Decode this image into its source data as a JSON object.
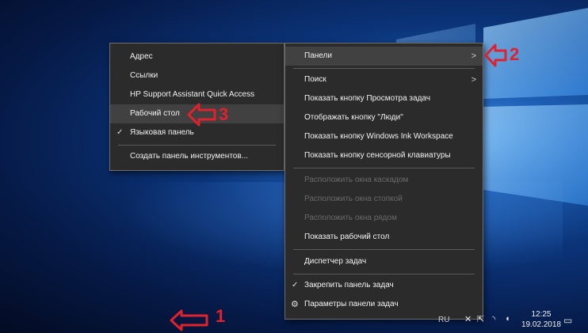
{
  "submenu": {
    "items": [
      {
        "label": "Адрес"
      },
      {
        "label": "Ссылки"
      },
      {
        "label": "HP Support Assistant Quick Access"
      },
      {
        "label": "Рабочий стол"
      },
      {
        "label": "Языковая панель"
      },
      {
        "label": "Создать панель инструментов..."
      }
    ]
  },
  "context_menu": {
    "items": [
      {
        "label": "Панели"
      },
      {
        "label": "Поиск"
      },
      {
        "label": "Показать кнопку Просмотра задач"
      },
      {
        "label": "Отображать кнопку \"Люди\""
      },
      {
        "label": "Показать кнопку Windows Ink Workspace"
      },
      {
        "label": "Показать кнопку сенсорной клавиатуры"
      },
      {
        "label": "Расположить окна каскадом"
      },
      {
        "label": "Расположить окна стопкой"
      },
      {
        "label": "Расположить окна рядом"
      },
      {
        "label": "Показать рабочий стол"
      },
      {
        "label": "Диспетчер задач"
      },
      {
        "label": "Закрепить панель задач"
      },
      {
        "label": "Параметры панели задач"
      }
    ]
  },
  "annotations": {
    "one": "1",
    "two": "2",
    "three": "3"
  },
  "tray": {
    "lang": "RU",
    "time": "12:25",
    "date": "19.02.2018"
  },
  "icons": {
    "chevron": "chevron-right-icon",
    "check": "checkmark-icon",
    "gear": "gear-icon"
  },
  "colors": {
    "menu_bg": "#2b2b2b",
    "highlight": "#414141",
    "annotation": "#e0212e",
    "disabled_text": "#6a6a6a"
  }
}
